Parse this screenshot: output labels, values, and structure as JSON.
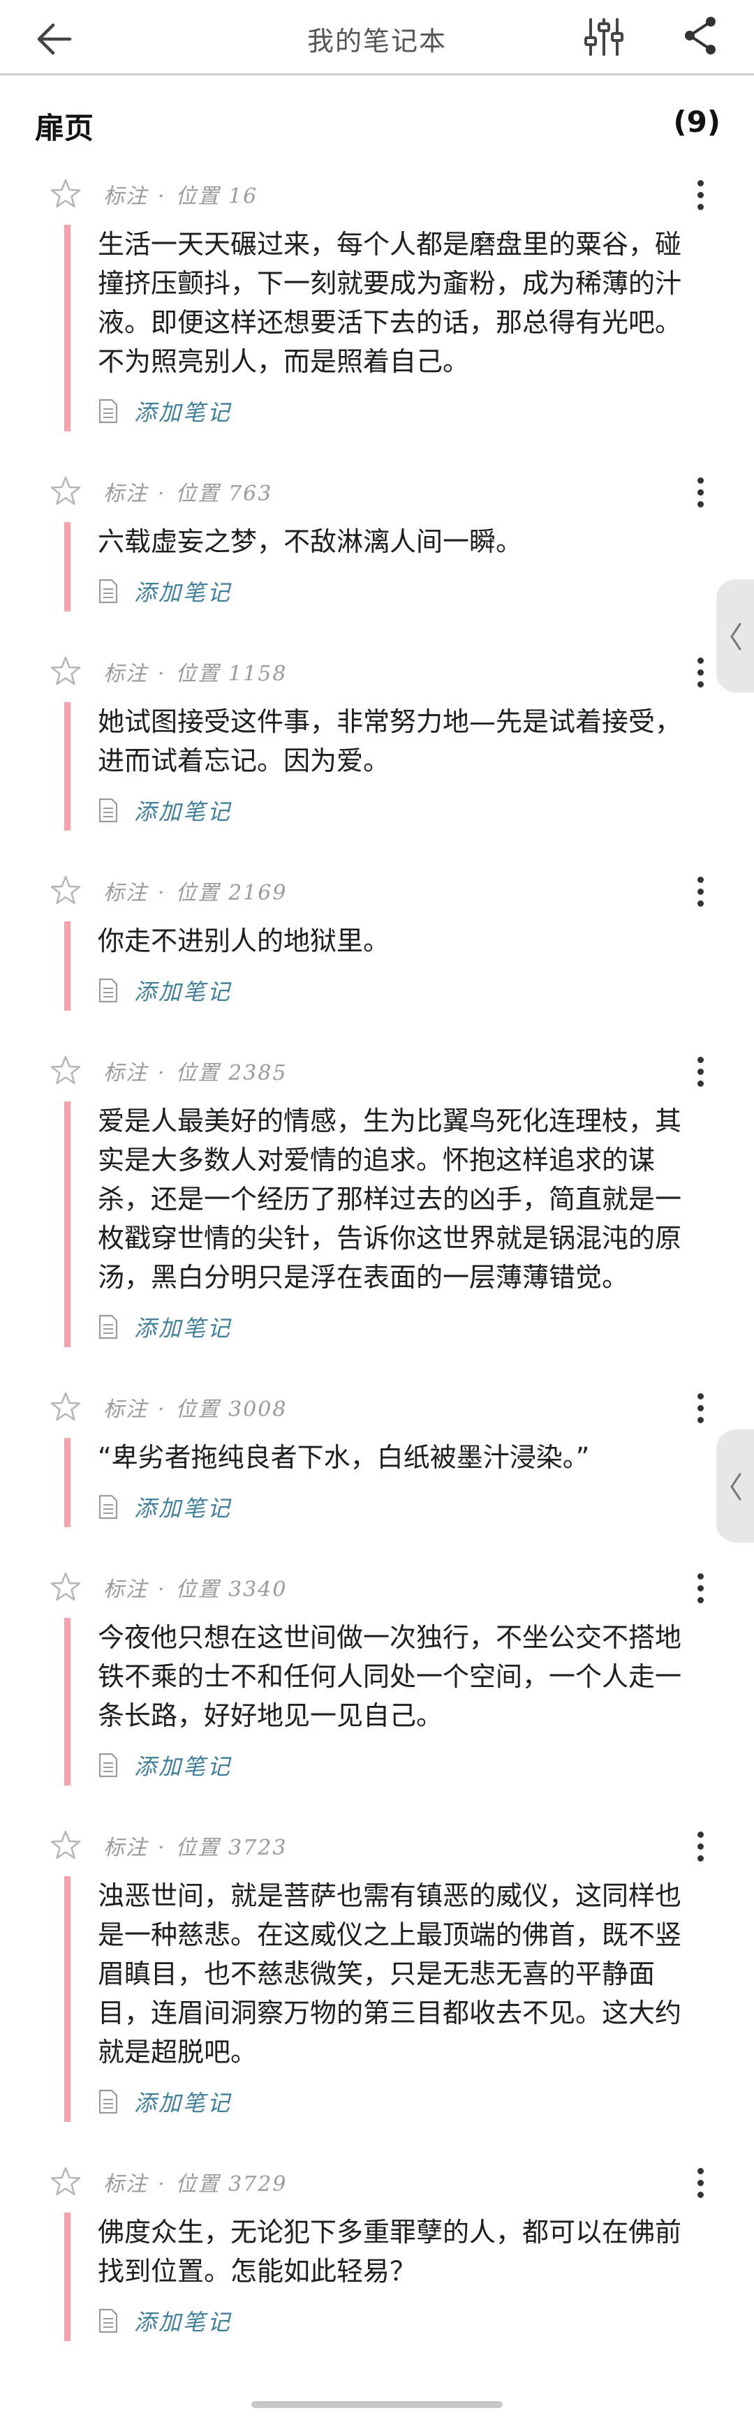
{
  "header": {
    "title": "我的笔记本",
    "icons": {
      "back": "back-arrow-icon",
      "filter": "filter-sliders-icon",
      "share": "share-icon"
    }
  },
  "section": {
    "title": "扉页",
    "count": "(9)"
  },
  "common": {
    "type_label": "标注",
    "separator": "·",
    "add_note_label": "添加笔记"
  },
  "colors": {
    "highlight_bar": "#f4a3ad",
    "link": "#3f7f9a",
    "meta": "#9b9b9b"
  },
  "notes": [
    {
      "location": "位置 16",
      "text": "生活一天天碾过来，每个人都是磨盘里的粟谷，碰撞挤压颤抖，下一刻就要成为齑粉，成为稀薄的汁液。即便这样还想要活下去的话，那总得有光吧。不为照亮别人，而是照着自己。"
    },
    {
      "location": "位置 763",
      "text": "六载虚妄之梦，不敌淋漓人间一瞬。"
    },
    {
      "location": "位置 1158",
      "text": "她试图接受这件事，非常努力地—先是试着接受，进而试着忘记。因为爱。"
    },
    {
      "location": "位置 2169",
      "text": "你走不进别人的地狱里。"
    },
    {
      "location": "位置 2385",
      "text": "爱是人最美好的情感，生为比翼鸟死化连理枝，其实是大多数人对爱情的追求。怀抱这样追求的谋杀，还是一个经历了那样过去的凶手，简直就是一枚戳穿世情的尖针，告诉你这世界就是锅混沌的原汤，黑白分明只是浮在表面的一层薄薄错觉。"
    },
    {
      "location": "位置 3008",
      "text": "“卑劣者拖纯良者下水，白纸被墨汁浸染。”"
    },
    {
      "location": "位置 3340",
      "text": "今夜他只想在这世间做一次独行，不坐公交不搭地铁不乘的士不和任何人同处一个空间，一个人走一条长路，好好地见一见自己。"
    },
    {
      "location": "位置 3723",
      "text": "浊恶世间，就是菩萨也需有镇恶的威仪，这同样也是一种慈悲。在这威仪之上最顶端的佛首，既不竖眉瞋目，也不慈悲微笑，只是无悲无喜的平静面目，连眉间洞察万物的第三目都收去不见。这大约就是超脱吧。"
    },
    {
      "location": "位置 3729",
      "text": "佛度众生，无论犯下多重罪孽的人，都可以在佛前找到位置。怎能如此轻易？"
    }
  ]
}
